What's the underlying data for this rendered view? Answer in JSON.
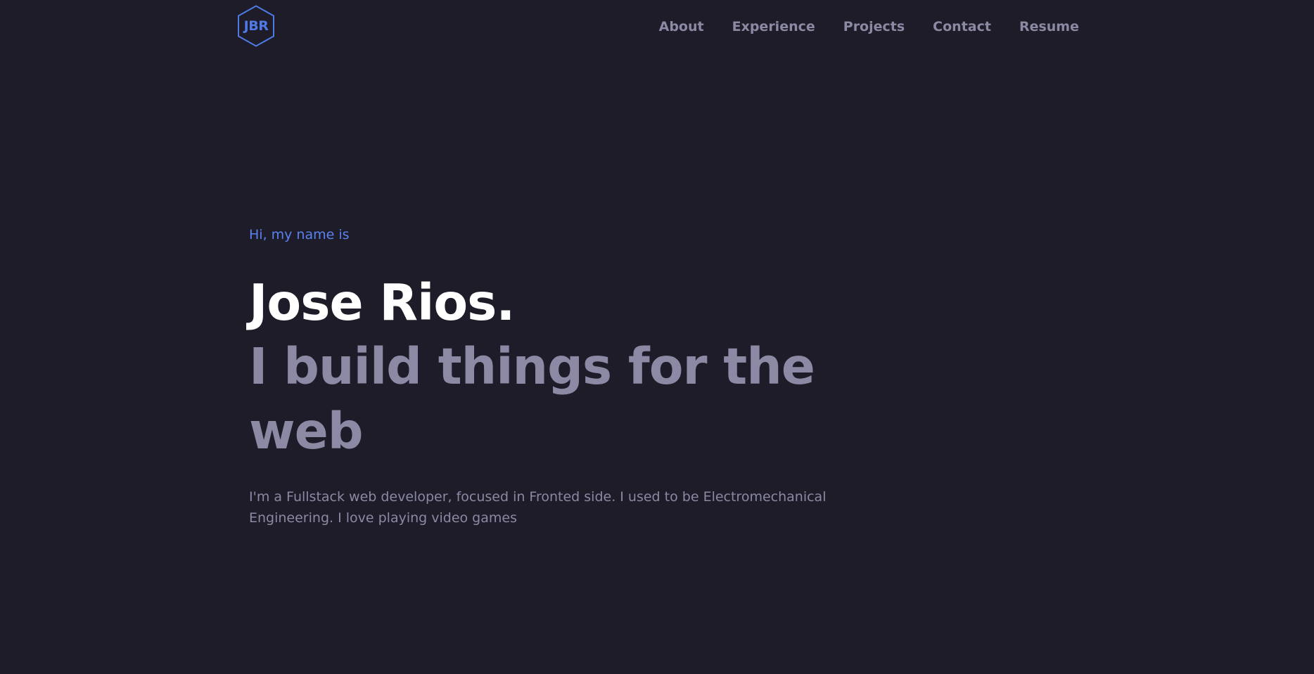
{
  "brand": {
    "logo_text": "JBR",
    "logo_color": "#4f7ae6"
  },
  "nav": {
    "items": [
      {
        "label": "About"
      },
      {
        "label": "Experience"
      },
      {
        "label": "Projects"
      },
      {
        "label": "Contact"
      },
      {
        "label": "Resume"
      }
    ]
  },
  "hero": {
    "greeting": "Hi, my name is",
    "name": "Jose Rios.",
    "tagline": "I build things for the web",
    "bio": "I'm a Fullstack web developer, focused in Fronted side. I used to be Electromechanical Engineering. I love playing video games"
  },
  "colors": {
    "background": "#1d1c28",
    "accent": "#5a82f0",
    "muted_text": "#8b89a3",
    "heading": "#ffffff"
  }
}
